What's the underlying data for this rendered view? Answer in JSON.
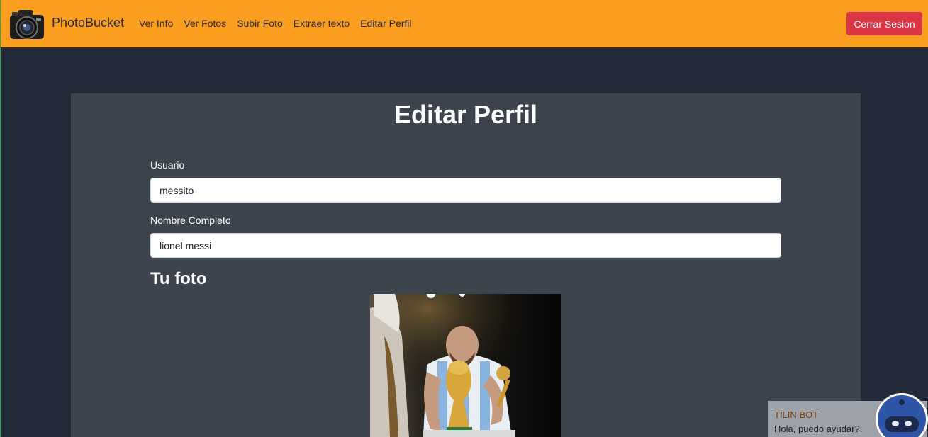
{
  "navbar": {
    "brand": "PhotoBucket",
    "links": [
      "Ver Info",
      "Ver Fotos",
      "Subir Foto",
      "Extraer texto",
      "Editar Perfil"
    ],
    "logout_label": "Cerrar Sesion",
    "background": "#fb9d1f"
  },
  "main": {
    "title": "Editar Perfil",
    "fields": [
      {
        "label": "Usuario",
        "value": "messito"
      },
      {
        "label": "Nombre Completo",
        "value": "lionel messi"
      }
    ],
    "photo_heading": "Tu foto"
  },
  "chatbot": {
    "name": "TILIN BOT",
    "message": "Hola, puedo ayudar?."
  },
  "colors": {
    "page_bg": "#232a3a",
    "card_bg": "#3d444d",
    "danger": "#dc3545"
  },
  "icons": [
    "camera-logo-icon",
    "robot-bot-icon"
  ]
}
